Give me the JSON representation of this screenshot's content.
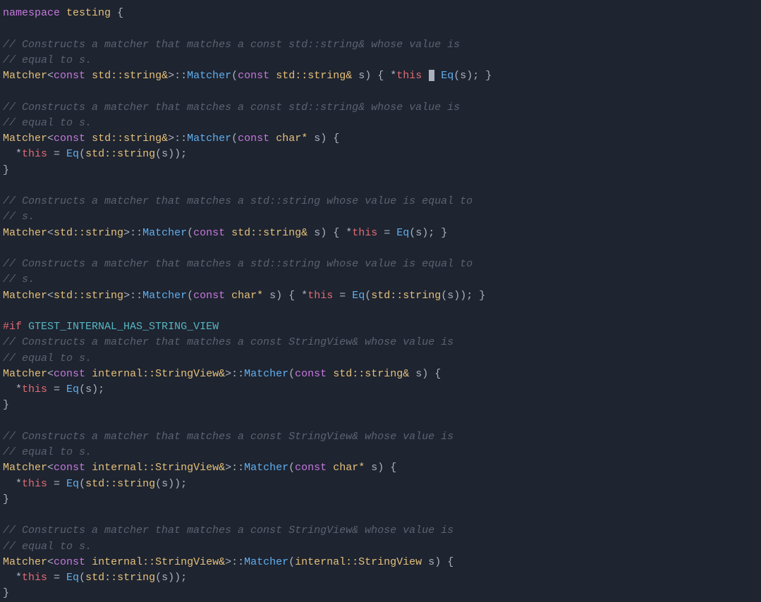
{
  "code": {
    "lines": [
      {
        "type": "normal",
        "segments": [
          {
            "cls": "kw-namespace",
            "text": "namespace"
          },
          {
            "cls": "",
            "text": " "
          },
          {
            "cls": "namespace-name",
            "text": "testing"
          },
          {
            "cls": "punct",
            "text": " {"
          }
        ]
      },
      {
        "type": "empty"
      },
      {
        "type": "normal",
        "segments": [
          {
            "cls": "comment",
            "text": "// Constructs a matcher that matches a const std::string& whose value is"
          }
        ]
      },
      {
        "type": "normal",
        "segments": [
          {
            "cls": "comment",
            "text": "// equal to s."
          }
        ]
      },
      {
        "type": "normal",
        "segments": [
          {
            "cls": "type",
            "text": "Matcher"
          },
          {
            "cls": "punct",
            "text": "<"
          },
          {
            "cls": "kw-const",
            "text": "const"
          },
          {
            "cls": "",
            "text": " "
          },
          {
            "cls": "type",
            "text": "std::string&"
          },
          {
            "cls": "punct",
            "text": ">"
          },
          {
            "cls": "punct",
            "text": "::"
          },
          {
            "cls": "method",
            "text": "Matcher"
          },
          {
            "cls": "punct",
            "text": "("
          },
          {
            "cls": "kw-const",
            "text": "const"
          },
          {
            "cls": "",
            "text": " "
          },
          {
            "cls": "type",
            "text": "std::string&"
          },
          {
            "cls": "",
            "text": " s) { *"
          },
          {
            "cls": "this-ptr",
            "text": "this"
          },
          {
            "cls": "",
            "text": " "
          },
          {
            "cls": "cursor-here",
            "text": ""
          },
          {
            "cls": "",
            "text": " "
          },
          {
            "cls": "fn-eq",
            "text": "Eq"
          },
          {
            "cls": "punct",
            "text": "(s); }"
          },
          {
            "cls": "",
            "text": ""
          }
        ]
      },
      {
        "type": "empty"
      },
      {
        "type": "normal",
        "segments": [
          {
            "cls": "comment",
            "text": "// Constructs a matcher that matches a const std::string& whose value is"
          }
        ]
      },
      {
        "type": "normal",
        "segments": [
          {
            "cls": "comment",
            "text": "// equal to s."
          }
        ]
      },
      {
        "type": "normal",
        "segments": [
          {
            "cls": "type",
            "text": "Matcher"
          },
          {
            "cls": "punct",
            "text": "<"
          },
          {
            "cls": "kw-const",
            "text": "const"
          },
          {
            "cls": "",
            "text": " "
          },
          {
            "cls": "type",
            "text": "std::string&"
          },
          {
            "cls": "punct",
            "text": ">"
          },
          {
            "cls": "punct",
            "text": "::"
          },
          {
            "cls": "method",
            "text": "Matcher"
          },
          {
            "cls": "punct",
            "text": "("
          },
          {
            "cls": "kw-const",
            "text": "const"
          },
          {
            "cls": "",
            "text": " "
          },
          {
            "cls": "type",
            "text": "char*"
          },
          {
            "cls": "",
            "text": " s) {"
          }
        ]
      },
      {
        "type": "normal",
        "segments": [
          {
            "cls": "",
            "text": "  *"
          },
          {
            "cls": "this-ptr",
            "text": "this"
          },
          {
            "cls": "",
            "text": " = "
          },
          {
            "cls": "fn-eq",
            "text": "Eq"
          },
          {
            "cls": "punct",
            "text": "("
          },
          {
            "cls": "type",
            "text": "std::string"
          },
          {
            "cls": "punct",
            "text": "(s));"
          }
        ]
      },
      {
        "type": "normal",
        "segments": [
          {
            "cls": "punct",
            "text": "}"
          }
        ]
      },
      {
        "type": "empty"
      },
      {
        "type": "normal",
        "segments": [
          {
            "cls": "comment",
            "text": "// Constructs a matcher that matches a std::string whose value is equal to"
          }
        ]
      },
      {
        "type": "normal",
        "segments": [
          {
            "cls": "comment",
            "text": "// s."
          }
        ]
      },
      {
        "type": "normal",
        "segments": [
          {
            "cls": "type",
            "text": "Matcher"
          },
          {
            "cls": "punct",
            "text": "<"
          },
          {
            "cls": "type",
            "text": "std::string"
          },
          {
            "cls": "punct",
            "text": ">"
          },
          {
            "cls": "punct",
            "text": "::"
          },
          {
            "cls": "method",
            "text": "Matcher"
          },
          {
            "cls": "punct",
            "text": "("
          },
          {
            "cls": "kw-const",
            "text": "const"
          },
          {
            "cls": "",
            "text": " "
          },
          {
            "cls": "type",
            "text": "std::string&"
          },
          {
            "cls": "",
            "text": " s) { *"
          },
          {
            "cls": "this-ptr",
            "text": "this"
          },
          {
            "cls": "",
            "text": " = "
          },
          {
            "cls": "fn-eq",
            "text": "Eq"
          },
          {
            "cls": "punct",
            "text": "(s); }"
          }
        ]
      },
      {
        "type": "empty"
      },
      {
        "type": "normal",
        "segments": [
          {
            "cls": "comment",
            "text": "// Constructs a matcher that matches a std::string whose value is equal to"
          }
        ]
      },
      {
        "type": "normal",
        "segments": [
          {
            "cls": "comment",
            "text": "// s."
          }
        ]
      },
      {
        "type": "normal",
        "segments": [
          {
            "cls": "type",
            "text": "Matcher"
          },
          {
            "cls": "punct",
            "text": "<"
          },
          {
            "cls": "type",
            "text": "std::string"
          },
          {
            "cls": "punct",
            "text": ">"
          },
          {
            "cls": "punct",
            "text": "::"
          },
          {
            "cls": "method",
            "text": "Matcher"
          },
          {
            "cls": "punct",
            "text": "("
          },
          {
            "cls": "kw-const",
            "text": "const"
          },
          {
            "cls": "",
            "text": " "
          },
          {
            "cls": "type",
            "text": "char*"
          },
          {
            "cls": "",
            "text": " s) { *"
          },
          {
            "cls": "this-ptr",
            "text": "this"
          },
          {
            "cls": "",
            "text": " = "
          },
          {
            "cls": "fn-eq",
            "text": "Eq"
          },
          {
            "cls": "punct",
            "text": "("
          },
          {
            "cls": "type",
            "text": "std::string"
          },
          {
            "cls": "punct",
            "text": "(s)); }"
          }
        ]
      },
      {
        "type": "empty"
      },
      {
        "type": "normal",
        "segments": [
          {
            "cls": "preprocessor",
            "text": "#if"
          },
          {
            "cls": "",
            "text": " "
          },
          {
            "cls": "preprocessor-name",
            "text": "GTEST_INTERNAL_HAS_STRING_VIEW"
          }
        ]
      },
      {
        "type": "normal",
        "segments": [
          {
            "cls": "comment",
            "text": "// Constructs a matcher that matches a const StringView& whose value is"
          }
        ]
      },
      {
        "type": "normal",
        "segments": [
          {
            "cls": "comment",
            "text": "// equal to s."
          }
        ]
      },
      {
        "type": "normal",
        "segments": [
          {
            "cls": "type",
            "text": "Matcher"
          },
          {
            "cls": "punct",
            "text": "<"
          },
          {
            "cls": "kw-const",
            "text": "const"
          },
          {
            "cls": "",
            "text": " "
          },
          {
            "cls": "type",
            "text": "internal::StringView&"
          },
          {
            "cls": "punct",
            "text": ">"
          },
          {
            "cls": "punct",
            "text": "::"
          },
          {
            "cls": "method",
            "text": "Matcher"
          },
          {
            "cls": "punct",
            "text": "("
          },
          {
            "cls": "kw-const",
            "text": "const"
          },
          {
            "cls": "",
            "text": " "
          },
          {
            "cls": "type",
            "text": "std::string&"
          },
          {
            "cls": "",
            "text": " s) {"
          }
        ]
      },
      {
        "type": "normal",
        "segments": [
          {
            "cls": "",
            "text": "  *"
          },
          {
            "cls": "this-ptr",
            "text": "this"
          },
          {
            "cls": "",
            "text": " = "
          },
          {
            "cls": "fn-eq",
            "text": "Eq"
          },
          {
            "cls": "punct",
            "text": "(s);"
          }
        ]
      },
      {
        "type": "normal",
        "segments": [
          {
            "cls": "punct",
            "text": "}"
          }
        ]
      },
      {
        "type": "empty"
      },
      {
        "type": "normal",
        "segments": [
          {
            "cls": "comment",
            "text": "// Constructs a matcher that matches a const StringView& whose value is"
          }
        ]
      },
      {
        "type": "normal",
        "segments": [
          {
            "cls": "comment",
            "text": "// equal to s."
          }
        ]
      },
      {
        "type": "normal",
        "segments": [
          {
            "cls": "type",
            "text": "Matcher"
          },
          {
            "cls": "punct",
            "text": "<"
          },
          {
            "cls": "kw-const",
            "text": "const"
          },
          {
            "cls": "",
            "text": " "
          },
          {
            "cls": "type",
            "text": "internal::StringView&"
          },
          {
            "cls": "punct",
            "text": ">"
          },
          {
            "cls": "punct",
            "text": "::"
          },
          {
            "cls": "method",
            "text": "Matcher"
          },
          {
            "cls": "punct",
            "text": "("
          },
          {
            "cls": "kw-const",
            "text": "const"
          },
          {
            "cls": "",
            "text": " "
          },
          {
            "cls": "type",
            "text": "char*"
          },
          {
            "cls": "",
            "text": " s) {"
          }
        ]
      },
      {
        "type": "normal",
        "segments": [
          {
            "cls": "",
            "text": "  *"
          },
          {
            "cls": "this-ptr",
            "text": "this"
          },
          {
            "cls": "",
            "text": " = "
          },
          {
            "cls": "fn-eq",
            "text": "Eq"
          },
          {
            "cls": "punct",
            "text": "("
          },
          {
            "cls": "type",
            "text": "std::string"
          },
          {
            "cls": "punct",
            "text": "(s));"
          }
        ]
      },
      {
        "type": "normal",
        "segments": [
          {
            "cls": "punct",
            "text": "}"
          }
        ]
      },
      {
        "type": "empty"
      },
      {
        "type": "normal",
        "segments": [
          {
            "cls": "comment",
            "text": "// Constructs a matcher that matches a const StringView& whose value is"
          }
        ]
      },
      {
        "type": "normal",
        "segments": [
          {
            "cls": "comment",
            "text": "// equal to s."
          }
        ]
      },
      {
        "type": "normal",
        "segments": [
          {
            "cls": "type",
            "text": "Matcher"
          },
          {
            "cls": "punct",
            "text": "<"
          },
          {
            "cls": "kw-const",
            "text": "const"
          },
          {
            "cls": "",
            "text": " "
          },
          {
            "cls": "type",
            "text": "internal::StringView&"
          },
          {
            "cls": "punct",
            "text": ">"
          },
          {
            "cls": "punct",
            "text": "::"
          },
          {
            "cls": "method",
            "text": "Matcher"
          },
          {
            "cls": "punct",
            "text": "("
          },
          {
            "cls": "type",
            "text": "internal::StringView"
          },
          {
            "cls": "",
            "text": " s) {"
          }
        ]
      },
      {
        "type": "normal",
        "segments": [
          {
            "cls": "",
            "text": "  *"
          },
          {
            "cls": "this-ptr",
            "text": "this"
          },
          {
            "cls": "",
            "text": " = "
          },
          {
            "cls": "fn-eq",
            "text": "Eq"
          },
          {
            "cls": "punct",
            "text": "("
          },
          {
            "cls": "type",
            "text": "std::string"
          },
          {
            "cls": "punct",
            "text": "(s));"
          }
        ]
      },
      {
        "type": "normal",
        "segments": [
          {
            "cls": "punct",
            "text": "}"
          }
        ]
      }
    ]
  }
}
